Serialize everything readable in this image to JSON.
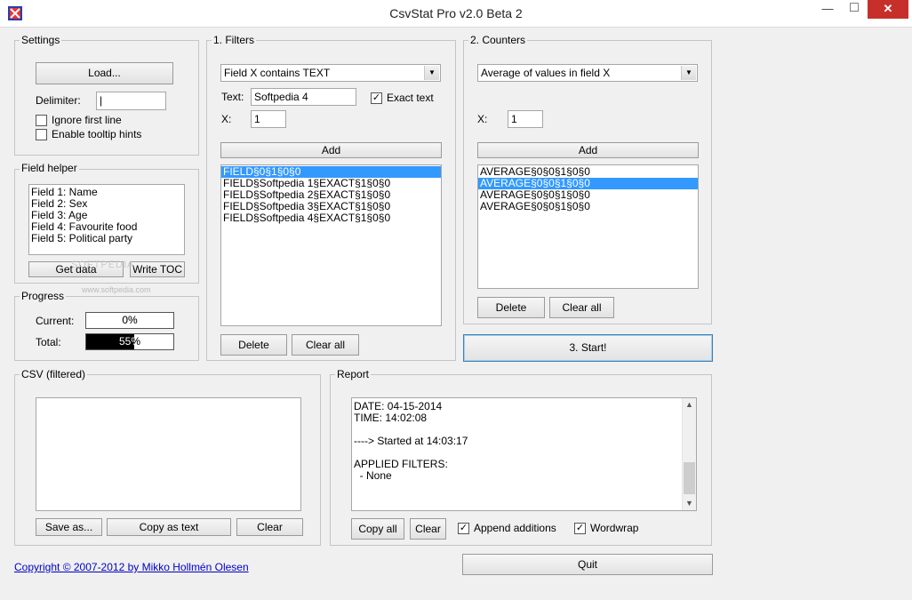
{
  "window": {
    "title": "CsvStat Pro v2.0 Beta 2",
    "minimize_icon": "minimize-icon",
    "maximize_icon": "maximize-icon",
    "close_icon": "close-icon"
  },
  "settings": {
    "title": "Settings",
    "load_label": "Load...",
    "delimiter_label": "Delimiter:",
    "delimiter_value": "|",
    "ignore_first_line": "Ignore first line",
    "enable_tooltip_hints": "Enable tooltip hints"
  },
  "field_helper": {
    "title": "Field helper",
    "fields": [
      "Field 1: Name",
      "Field 2: Sex",
      "Field 3: Age",
      "Field 4: Favourite food",
      "Field 5: Political party"
    ],
    "get_data_label": "Get data",
    "write_toc_label": "Write TOC"
  },
  "progress": {
    "title": "Progress",
    "current_label": "Current:",
    "current_text": "0%",
    "current_fraction": 0,
    "total_label": "Total:",
    "total_text": "55%",
    "total_fraction": 0.55
  },
  "filters": {
    "title": "1. Filters",
    "mode_selected": "Field X contains TEXT",
    "text_label": "Text:",
    "text_value": "Softpedia 4",
    "exact_text_label": "Exact text",
    "exact_text_checked": true,
    "x_label": "X:",
    "x_value": "1",
    "add_label": "Add",
    "items": [
      "FIELD§0§1§0§0",
      "FIELD§Softpedia 1§EXACT§1§0§0",
      "FIELD§Softpedia 2§EXACT§1§0§0",
      "FIELD§Softpedia 3§EXACT§1§0§0",
      "FIELD§Softpedia 4§EXACT§1§0§0"
    ],
    "selected_index": 0,
    "delete_label": "Delete",
    "clear_all_label": "Clear all"
  },
  "counters": {
    "title": "2. Counters",
    "mode_selected": "Average of values in field X",
    "x_label": "X:",
    "x_value": "1",
    "add_label": "Add",
    "items": [
      "AVERAGE§0§0§1§0§0",
      "AVERAGE§0§0§1§0§0",
      "AVERAGE§0§0§1§0§0",
      "AVERAGE§0§0§1§0§0"
    ],
    "selected_index": 1,
    "delete_label": "Delete",
    "clear_all_label": "Clear all"
  },
  "start_label": "3. Start!",
  "csv": {
    "title": "CSV (filtered)",
    "content": "",
    "save_as_label": "Save as...",
    "copy_as_text_label": "Copy as text",
    "clear_label": "Clear"
  },
  "report": {
    "title": "Report",
    "lines": [
      "DATE: 04-15-2014",
      "TIME: 14:02:08",
      "",
      "----> Started at 14:03:17",
      "",
      "APPLIED FILTERS:",
      "  - None"
    ],
    "copy_all_label": "Copy all",
    "clear_label": "Clear",
    "append_additions_label": "Append additions",
    "append_additions_checked": true,
    "wordwrap_label": "Wordwrap",
    "wordwrap_checked": true
  },
  "copyright": "Copyright © 2007-2012 by Mikko Hollmén Olesen",
  "quit_label": "Quit",
  "watermark": "SOFTPEDIA",
  "watermark_url": "www.softpedia.com",
  "colors": {
    "selection": "#3399ff",
    "close_button": "#c7302a",
    "link": "#0000c8"
  }
}
